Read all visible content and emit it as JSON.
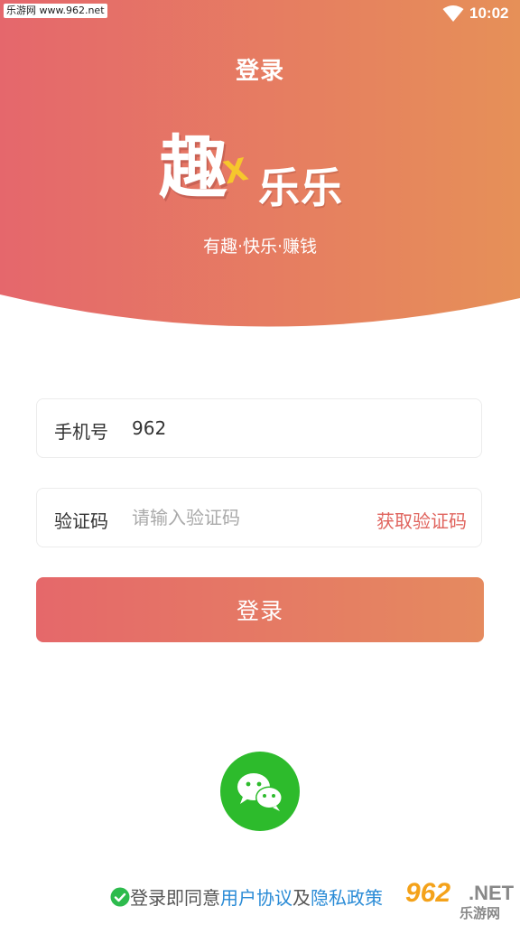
{
  "status_bar": {
    "watermark": "乐游网 www.962.net",
    "time": "10:02",
    "wifi_icon": "wifi-icon"
  },
  "header": {
    "title": "登录",
    "logo_main": "趣",
    "logo_accent": "X",
    "logo_sub": "乐乐",
    "slogan": "有趣·快乐·赚钱",
    "gradient_start": "#e5676c",
    "gradient_end": "#e69058"
  },
  "form": {
    "phone": {
      "label": "手机号",
      "value": "962",
      "placeholder": ""
    },
    "code": {
      "label": "验证码",
      "value": "",
      "placeholder": "请输入验证码",
      "get_code_label": "获取验证码"
    },
    "login_label": "登录"
  },
  "wechat_login": {
    "icon": "wechat-icon",
    "color": "#2dbb2c"
  },
  "agreement": {
    "checked": true,
    "prefix": "登录即同意",
    "user_agreement": "用户协议",
    "conjunction": "及",
    "privacy_policy": "隐私政策"
  },
  "watermark_corner": {
    "number": "962",
    "suffix": ".NET",
    "cn": "乐游网"
  }
}
